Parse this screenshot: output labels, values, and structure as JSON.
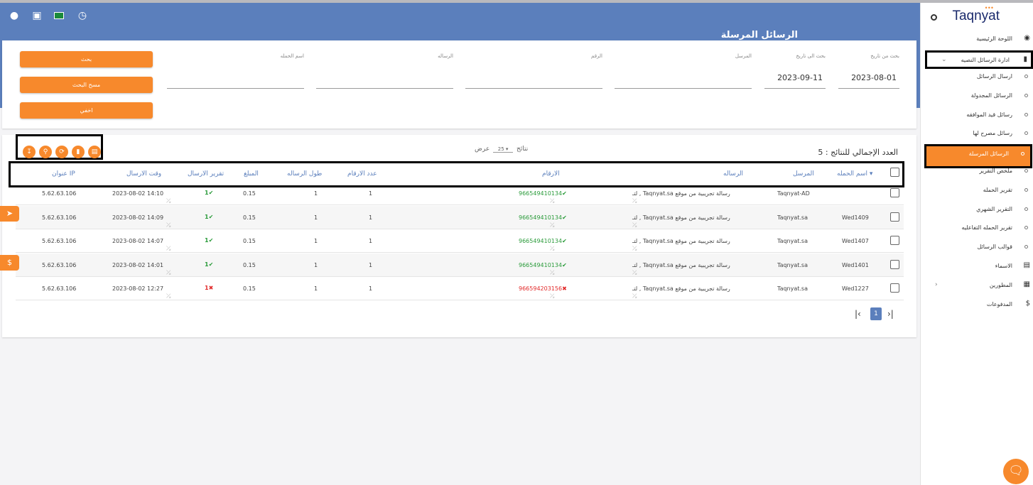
{
  "header": {
    "title": "الرسائل المرسلة",
    "icons": [
      "user-circle-icon",
      "fullscreen-icon",
      "saudi-flag-icon",
      "clock-icon"
    ]
  },
  "filters": {
    "date_from": {
      "label": "بحث من تاريخ",
      "value": "2023-08-01"
    },
    "date_to": {
      "label": "بحث الى تاريخ",
      "value": "2023-09-11"
    },
    "sender": {
      "label": "المرسل",
      "value": ""
    },
    "number": {
      "label": "الرقم",
      "value": ""
    },
    "message": {
      "label": "الرساله",
      "value": ""
    },
    "campaign": {
      "label": "اسم الحمله",
      "value": ""
    },
    "search_btn": "بحث",
    "clear_btn": "مسح البحث",
    "hide_btn": "اخفي"
  },
  "toolbar": {
    "icons": [
      "download-icon",
      "search-icon",
      "refresh-icon",
      "delete-icon",
      "copy-icon"
    ]
  },
  "results": {
    "total": "العدد الإجمالي للنتائج : 5",
    "show_label": "عرض",
    "page_size": "25",
    "results_label": "نتائج"
  },
  "table": {
    "headers": {
      "campaign": "اسم الحمله",
      "sender": "المرسل",
      "message": "الرساله",
      "numbers": "الارقام",
      "count": "عدد الارقام",
      "length": "طول الرساله",
      "amount": "المبلغ",
      "report": "تقرير الارسال",
      "time": "وقت الارسال",
      "ip": "عنوان IP"
    },
    "rows": [
      {
        "campaign": "",
        "sender": "Taqnyat-AD",
        "message": "رسالة تجريبية من موقع Taqnyat.sa , لتـ",
        "number": "966549410134",
        "number_status": "ok",
        "count": "1",
        "length": "1",
        "amount": "0.15",
        "report": "1",
        "report_status": "ok",
        "time": "2023-08-02 14:10",
        "ip": "5.62.63.106"
      },
      {
        "campaign": "Wed1409",
        "sender": "Taqnyat.sa",
        "message": "رسالة تجريبية من موقع Taqnyat.sa , لتـ",
        "number": "966549410134",
        "number_status": "ok",
        "count": "1",
        "length": "1",
        "amount": "0.15",
        "report": "1",
        "report_status": "ok",
        "time": "2023-08-02 14:09",
        "ip": "5.62.63.106"
      },
      {
        "campaign": "Wed1407",
        "sender": "Taqnyat.sa",
        "message": "رسالة تجريبية من موقع Taqnyat.sa , لتـ",
        "number": "966549410134",
        "number_status": "ok",
        "count": "1",
        "length": "1",
        "amount": "0.15",
        "report": "1",
        "report_status": "ok",
        "time": "2023-08-02 14:07",
        "ip": "5.62.63.106"
      },
      {
        "campaign": "Wed1401",
        "sender": "Taqnyat.sa",
        "message": "رسالة تجريبية من موقع Taqnyat.sa , لتـ",
        "number": "966549410134",
        "number_status": "ok",
        "count": "1",
        "length": "1",
        "amount": "0.15",
        "report": "1",
        "report_status": "ok",
        "time": "2023-08-02 14:01",
        "ip": "5.62.63.106"
      },
      {
        "campaign": "Wed1227",
        "sender": "Taqnyat.sa",
        "message": "رسالة تجريبية من موقع Taqnyat.sa , لتـ",
        "number": "966594203156",
        "number_status": "fail",
        "count": "1",
        "length": "1",
        "amount": "0.15",
        "report": "1",
        "report_status": "fail",
        "time": "2023-08-02 12:27",
        "ip": "5.62.63.106"
      }
    ]
  },
  "pagination": {
    "current": "1"
  },
  "sidebar": {
    "logo": "Taqnyat",
    "items": [
      {
        "label": "اللوحة الرئيسية",
        "icon": "palette-icon"
      },
      {
        "label": "ادارة الرسائل النصيه",
        "icon": "book-icon"
      },
      {
        "label": "ارسال الرسائل"
      },
      {
        "label": "الرسائل المجدولة"
      },
      {
        "label": "رسائل قيد الموافقه"
      },
      {
        "label": "رسائل مصرح لها"
      },
      {
        "label": "الرسائل المرسلة"
      },
      {
        "label": "ملخص التقرير"
      },
      {
        "label": "تقرير الحمله"
      },
      {
        "label": "التقرير الشهري"
      },
      {
        "label": "تقرير الحمله التفاعليه"
      },
      {
        "label": "قوالب الرسائل"
      },
      {
        "label": "الاسماء",
        "icon": "contacts-icon"
      },
      {
        "label": "المطورين",
        "icon": "code-book-icon"
      },
      {
        "label": "المدفوعات",
        "icon": "dollar-icon"
      }
    ]
  },
  "colors": {
    "accent": "#f7892c",
    "header": "#5b7fbc",
    "ok": "#2a9b3a",
    "fail": "#e22a2a"
  }
}
